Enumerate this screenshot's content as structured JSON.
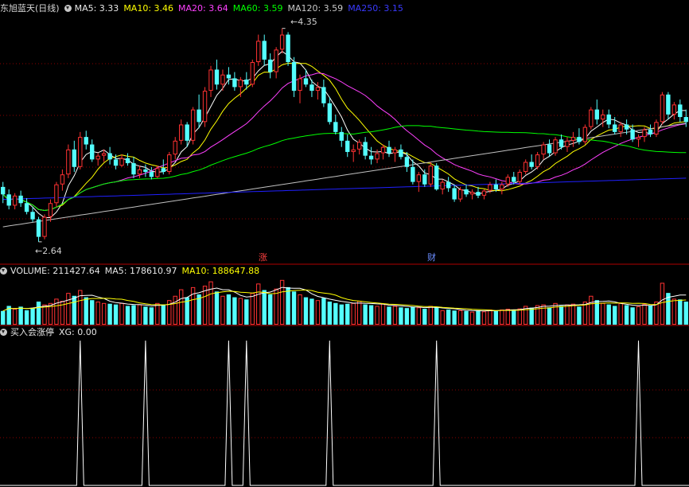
{
  "header_main": {
    "stock_title": "东旭蓝天(日线)",
    "ma5": "MA5: 3.33",
    "ma10": "MA10: 3.46",
    "ma20": "MA20: 3.64",
    "ma60": "MA60: 3.59",
    "ma120": "MA120: 3.59",
    "ma250": "MA250: 3.15"
  },
  "header_volume": {
    "volume": "VOLUME: 211427.64",
    "ma5": "MA5: 178610.97",
    "ma10": "MA10: 188647.88"
  },
  "header_indicator": {
    "name": "买入会涨停",
    "xg": "XG: 0.00"
  },
  "annotations": {
    "high": "4.35",
    "low": "2.64",
    "zhang": "涨",
    "cai": "财"
  },
  "colors": {
    "up": "#ff3232",
    "down": "#54ffff",
    "ma5": "#ffffff",
    "ma10": "#ffff00",
    "ma20": "#ff40ff",
    "ma60": "#00ff00",
    "ma120": "#c0c0c0",
    "ma250": "#2020ff",
    "grid": "#8b0000",
    "divider": "#b00000"
  },
  "chart_data": [
    {
      "type": "candlestick",
      "title": "东旭蓝天(日线)",
      "price_range": [
        2.55,
        4.45
      ],
      "high_label": 4.35,
      "low_label": 2.64,
      "ohlc": [
        [
          3.08,
          3.12,
          2.95,
          3.02
        ],
        [
          3.02,
          3.06,
          2.9,
          2.93
        ],
        [
          2.93,
          3.03,
          2.9,
          3.01
        ],
        [
          3.01,
          3.05,
          2.92,
          2.95
        ],
        [
          2.95,
          2.99,
          2.86,
          2.88
        ],
        [
          2.88,
          2.92,
          2.8,
          2.82
        ],
        [
          2.82,
          2.84,
          2.64,
          2.68
        ],
        [
          2.68,
          2.86,
          2.66,
          2.84
        ],
        [
          2.84,
          2.98,
          2.8,
          2.95
        ],
        [
          2.95,
          3.12,
          2.92,
          3.1
        ],
        [
          3.1,
          3.22,
          3.05,
          3.18
        ],
        [
          3.18,
          3.42,
          3.15,
          3.38
        ],
        [
          3.38,
          3.45,
          3.2,
          3.24
        ],
        [
          3.24,
          3.52,
          3.22,
          3.48
        ],
        [
          3.48,
          3.53,
          3.38,
          3.42
        ],
        [
          3.42,
          3.46,
          3.28,
          3.3
        ],
        [
          3.3,
          3.35,
          3.25,
          3.33
        ],
        [
          3.33,
          3.38,
          3.28,
          3.35
        ],
        [
          3.35,
          3.4,
          3.26,
          3.3
        ],
        [
          3.3,
          3.34,
          3.22,
          3.25
        ],
        [
          3.25,
          3.34,
          3.24,
          3.31
        ],
        [
          3.31,
          3.35,
          3.25,
          3.27
        ],
        [
          3.27,
          3.32,
          3.15,
          3.18
        ],
        [
          3.18,
          3.25,
          3.15,
          3.22
        ],
        [
          3.22,
          3.26,
          3.16,
          3.2
        ],
        [
          3.2,
          3.24,
          3.14,
          3.16
        ],
        [
          3.16,
          3.25,
          3.15,
          3.23
        ],
        [
          3.23,
          3.3,
          3.18,
          3.2
        ],
        [
          3.2,
          3.36,
          3.18,
          3.34
        ],
        [
          3.34,
          3.48,
          3.3,
          3.45
        ],
        [
          3.45,
          3.62,
          3.42,
          3.58
        ],
        [
          3.58,
          3.6,
          3.4,
          3.45
        ],
        [
          3.45,
          3.72,
          3.42,
          3.7
        ],
        [
          3.7,
          3.82,
          3.55,
          3.6
        ],
        [
          3.6,
          3.88,
          3.56,
          3.85
        ],
        [
          3.85,
          4.05,
          3.8,
          4.02
        ],
        [
          4.02,
          4.1,
          3.86,
          3.9
        ],
        [
          3.9,
          4.02,
          3.85,
          3.98
        ],
        [
          3.98,
          4.04,
          3.9,
          3.95
        ],
        [
          3.95,
          4.0,
          3.85,
          3.88
        ],
        [
          3.88,
          3.96,
          3.8,
          3.94
        ],
        [
          3.94,
          4.0,
          3.86,
          3.9
        ],
        [
          3.9,
          4.1,
          3.88,
          4.08
        ],
        [
          4.08,
          4.3,
          4.05,
          4.25
        ],
        [
          4.25,
          4.3,
          4.05,
          4.1
        ],
        [
          4.1,
          4.15,
          3.95,
          4.0
        ],
        [
          4.0,
          4.2,
          3.95,
          4.18
        ],
        [
          4.18,
          4.35,
          4.15,
          4.3
        ],
        [
          4.3,
          4.32,
          4.05,
          4.08
        ],
        [
          4.08,
          4.12,
          3.8,
          3.85
        ],
        [
          3.85,
          3.98,
          3.75,
          3.95
        ],
        [
          3.95,
          4.02,
          3.88,
          3.9
        ],
        [
          3.9,
          3.94,
          3.8,
          3.85
        ],
        [
          3.85,
          3.92,
          3.78,
          3.88
        ],
        [
          3.88,
          3.94,
          3.72,
          3.75
        ],
        [
          3.75,
          3.8,
          3.58,
          3.6
        ],
        [
          3.6,
          3.66,
          3.5,
          3.52
        ],
        [
          3.52,
          3.56,
          3.4,
          3.45
        ],
        [
          3.45,
          3.5,
          3.32,
          3.36
        ],
        [
          3.36,
          3.42,
          3.28,
          3.38
        ],
        [
          3.38,
          3.46,
          3.34,
          3.44
        ],
        [
          3.44,
          3.48,
          3.3,
          3.33
        ],
        [
          3.33,
          3.4,
          3.26,
          3.3
        ],
        [
          3.3,
          3.38,
          3.27,
          3.35
        ],
        [
          3.35,
          3.42,
          3.3,
          3.4
        ],
        [
          3.4,
          3.45,
          3.32,
          3.35
        ],
        [
          3.35,
          3.4,
          3.28,
          3.38
        ],
        [
          3.38,
          3.42,
          3.3,
          3.32
        ],
        [
          3.32,
          3.36,
          3.2,
          3.24
        ],
        [
          3.24,
          3.3,
          3.1,
          3.12
        ],
        [
          3.12,
          3.2,
          3.04,
          3.18
        ],
        [
          3.18,
          3.22,
          3.08,
          3.1
        ],
        [
          3.1,
          3.28,
          3.08,
          3.25
        ],
        [
          3.25,
          3.27,
          3.05,
          3.06
        ],
        [
          3.06,
          3.14,
          3.02,
          3.12
        ],
        [
          3.12,
          3.16,
          3.04,
          3.07
        ],
        [
          3.07,
          3.1,
          2.96,
          2.98
        ],
        [
          2.98,
          3.08,
          2.96,
          3.06
        ],
        [
          3.06,
          3.1,
          3.0,
          3.02
        ],
        [
          3.02,
          3.06,
          2.98,
          3.04
        ],
        [
          3.04,
          3.08,
          2.99,
          3.01
        ],
        [
          3.01,
          3.06,
          2.98,
          3.05
        ],
        [
          3.05,
          3.12,
          3.03,
          3.1
        ],
        [
          3.1,
          3.14,
          3.04,
          3.06
        ],
        [
          3.06,
          3.12,
          3.02,
          3.1
        ],
        [
          3.1,
          3.18,
          3.08,
          3.16
        ],
        [
          3.16,
          3.2,
          3.1,
          3.12
        ],
        [
          3.12,
          3.22,
          3.1,
          3.2
        ],
        [
          3.2,
          3.3,
          3.18,
          3.28
        ],
        [
          3.28,
          3.34,
          3.22,
          3.24
        ],
        [
          3.24,
          3.36,
          3.22,
          3.34
        ],
        [
          3.34,
          3.44,
          3.3,
          3.42
        ],
        [
          3.42,
          3.46,
          3.32,
          3.35
        ],
        [
          3.35,
          3.48,
          3.33,
          3.46
        ],
        [
          3.46,
          3.5,
          3.38,
          3.4
        ],
        [
          3.4,
          3.48,
          3.36,
          3.45
        ],
        [
          3.45,
          3.52,
          3.4,
          3.48
        ],
        [
          3.48,
          3.55,
          3.42,
          3.44
        ],
        [
          3.44,
          3.58,
          3.42,
          3.56
        ],
        [
          3.56,
          3.72,
          3.54,
          3.7
        ],
        [
          3.7,
          3.78,
          3.58,
          3.62
        ],
        [
          3.62,
          3.7,
          3.56,
          3.66
        ],
        [
          3.66,
          3.7,
          3.55,
          3.58
        ],
        [
          3.58,
          3.64,
          3.5,
          3.52
        ],
        [
          3.52,
          3.6,
          3.48,
          3.58
        ],
        [
          3.58,
          3.62,
          3.5,
          3.54
        ],
        [
          3.54,
          3.58,
          3.44,
          3.46
        ],
        [
          3.46,
          3.5,
          3.4,
          3.48
        ],
        [
          3.48,
          3.56,
          3.44,
          3.54
        ],
        [
          3.54,
          3.58,
          3.48,
          3.5
        ],
        [
          3.5,
          3.62,
          3.48,
          3.6
        ],
        [
          3.6,
          3.84,
          3.58,
          3.82
        ],
        [
          3.82,
          3.84,
          3.62,
          3.66
        ],
        [
          3.66,
          3.76,
          3.62,
          3.74
        ],
        [
          3.74,
          3.78,
          3.6,
          3.64
        ],
        [
          3.64,
          3.7,
          3.56,
          3.6
        ]
      ],
      "moving_averages": [
        {
          "name": "MA5",
          "value": 3.33
        },
        {
          "name": "MA10",
          "value": 3.46
        },
        {
          "name": "MA20",
          "value": 3.64
        },
        {
          "name": "MA60",
          "value": 3.59
        },
        {
          "name": "MA120",
          "value": 3.59
        },
        {
          "name": "MA250",
          "value": 3.15
        }
      ]
    },
    {
      "type": "bar",
      "title": "VOLUME",
      "ylim": [
        0,
        320000
      ],
      "values": [
        95000,
        130000,
        110000,
        125000,
        100000,
        115000,
        160000,
        140000,
        150000,
        180000,
        165000,
        220000,
        200000,
        240000,
        190000,
        170000,
        160000,
        150000,
        145000,
        140000,
        150000,
        130000,
        135000,
        140000,
        125000,
        120000,
        150000,
        140000,
        170000,
        200000,
        245000,
        190000,
        260000,
        210000,
        270000,
        300000,
        230000,
        200000,
        210000,
        190000,
        185000,
        175000,
        220000,
        285000,
        240000,
        210000,
        250000,
        310000,
        260000,
        230000,
        210000,
        190000,
        180000,
        170000,
        185000,
        160000,
        150000,
        140000,
        145000,
        150000,
        165000,
        140000,
        135000,
        130000,
        145000,
        125000,
        130000,
        120000,
        115000,
        125000,
        120000,
        110000,
        130000,
        120000,
        100000,
        105000,
        98000,
        100000,
        95000,
        90000,
        100000,
        92000,
        105000,
        95000,
        105000,
        110000,
        100000,
        112000,
        130000,
        118000,
        135000,
        140000,
        120000,
        150000,
        130000,
        140000,
        145000,
        125000,
        160000,
        200000,
        170000,
        150000,
        140000,
        130000,
        150000,
        135000,
        120000,
        128000,
        145000,
        135000,
        160000,
        290000,
        220000,
        180000,
        175000,
        160000
      ]
    },
    {
      "type": "line",
      "title": "买入会涨停",
      "series": [
        {
          "name": "XG",
          "value": 0.0,
          "signal_indices": [
            13,
            24,
            38,
            41,
            55,
            73,
            107
          ]
        }
      ]
    }
  ]
}
